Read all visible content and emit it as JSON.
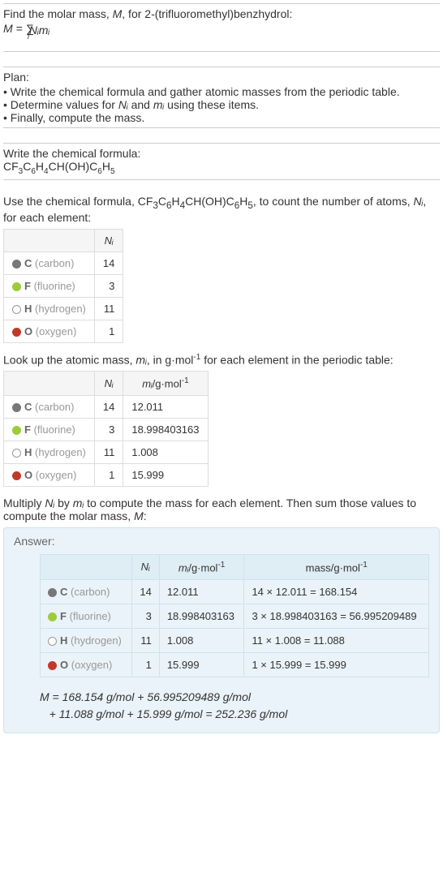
{
  "intro": {
    "line1a": "Find the molar mass, ",
    "line1b": "M",
    "line1c": ", for 2-(trifluoromethyl)benzhydrol:",
    "formula": "M = ∑",
    "formula_sub": "i",
    "formula_tail": " Nᵢmᵢ"
  },
  "plan": {
    "title": "Plan:",
    "b1": "• Write the chemical formula and gather atomic masses from the periodic table.",
    "b2a": "• Determine values for ",
    "b2b": "Nᵢ",
    "b2c": " and ",
    "b2d": "mᵢ",
    "b2e": " using these items.",
    "b3": "• Finally, compute the mass."
  },
  "write_formula": {
    "title": "Write the chemical formula:",
    "pre": "CF",
    "s1": "3",
    "c1": "C",
    "s2": "6",
    "h1": "H",
    "s3": "4",
    "mid": "CH(OH)C",
    "s4": "6",
    "h2": "H",
    "s5": "5"
  },
  "count_atoms": {
    "text_a": "Use the chemical formula, CF",
    "s1": "3",
    "c1": "C",
    "s2": "6",
    "h1": "H",
    "s3": "4",
    "mid": "CH(OH)C",
    "s4": "6",
    "h2": "H",
    "s5": "5",
    "text_b": ", to count the number of atoms, ",
    "ni": "Nᵢ",
    "text_c": ", for each element:"
  },
  "table1": {
    "header_ni": "Nᵢ",
    "rows": [
      {
        "dot": "#777",
        "sym": "C",
        "name": "(carbon)",
        "n": "14"
      },
      {
        "dot": "#9ecb3a",
        "sym": "F",
        "name": "(fluorine)",
        "n": "3"
      },
      {
        "dot_border": "#999",
        "dot": "#fff",
        "sym": "H",
        "name": "(hydrogen)",
        "n": "11"
      },
      {
        "dot": "#c0392b",
        "sym": "O",
        "name": "(oxygen)",
        "n": "1"
      }
    ]
  },
  "lookup": {
    "text_a": "Look up the atomic mass, ",
    "mi": "mᵢ",
    "text_b": ", in g·mol",
    "exp": "-1",
    "text_c": " for each element in the periodic table:"
  },
  "table2": {
    "header_ni": "Nᵢ",
    "header_mi_a": "mᵢ",
    "header_mi_b": "/g·mol",
    "header_mi_exp": "-1",
    "rows": [
      {
        "dot": "#777",
        "sym": "C",
        "name": "(carbon)",
        "n": "14",
        "m": "12.011"
      },
      {
        "dot": "#9ecb3a",
        "sym": "F",
        "name": "(fluorine)",
        "n": "3",
        "m": "18.998403163"
      },
      {
        "dot_border": "#999",
        "dot": "#fff",
        "sym": "H",
        "name": "(hydrogen)",
        "n": "11",
        "m": "1.008"
      },
      {
        "dot": "#c0392b",
        "sym": "O",
        "name": "(oxygen)",
        "n": "1",
        "m": "15.999"
      }
    ]
  },
  "multiply": {
    "text_a": "Multiply ",
    "ni": "Nᵢ",
    "text_b": " by ",
    "mi": "mᵢ",
    "text_c": " to compute the mass for each element. Then sum those values to compute the molar mass, ",
    "M": "M",
    "text_d": ":"
  },
  "answer": {
    "label": "Answer:",
    "header_ni": "Nᵢ",
    "header_mi_a": "mᵢ",
    "header_mi_b": "/g·mol",
    "header_mi_exp": "-1",
    "header_mass_a": "mass/g·mol",
    "header_mass_exp": "-1",
    "rows": [
      {
        "dot": "#777",
        "sym": "C",
        "name": "(carbon)",
        "n": "14",
        "m": "12.011",
        "mass": "14 × 12.011 = 168.154"
      },
      {
        "dot": "#9ecb3a",
        "sym": "F",
        "name": "(fluorine)",
        "n": "3",
        "m": "18.998403163",
        "mass": "3 × 18.998403163 = 56.995209489"
      },
      {
        "dot_border": "#999",
        "dot": "#fff",
        "sym": "H",
        "name": "(hydrogen)",
        "n": "11",
        "m": "1.008",
        "mass": "11 × 1.008 = 11.088"
      },
      {
        "dot": "#c0392b",
        "sym": "O",
        "name": "(oxygen)",
        "n": "1",
        "m": "15.999",
        "mass": "1 × 15.999 = 15.999"
      }
    ],
    "final_a": "M",
    "final_b": " = 168.154 g/mol + 56.995209489 g/mol",
    "final_c": "+ 11.088 g/mol + 15.999 g/mol = 252.236 g/mol"
  }
}
